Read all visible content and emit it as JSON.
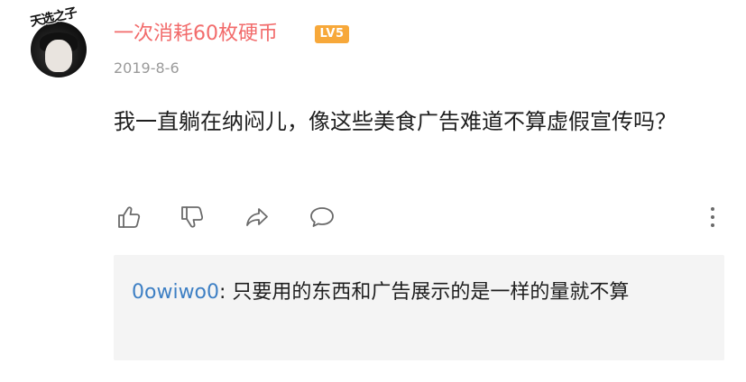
{
  "comment": {
    "username": "一次消耗60枚硬币",
    "level": "LV5",
    "date": "2019-8-6",
    "text": "我一直躺在纳闷儿，像这些美食广告难道不算虚假宣传吗？",
    "avatar_sticker_text": "天选之子"
  },
  "actions": {
    "like_icon": "thumbs-up-icon",
    "dislike_icon": "thumbs-down-icon",
    "share_icon": "share-arrow-icon",
    "comment_icon": "speech-bubble-icon",
    "more_icon": "vertical-ellipsis-icon"
  },
  "reply": {
    "username": "0owiwo0",
    "separator": ": ",
    "text": "只要用的东西和广告展示的是一样的量就不算"
  },
  "colors": {
    "username": "#f26b6b",
    "level_badge": "#f7a83a",
    "reply_username": "#3d7fc4",
    "reply_background": "#f4f4f4",
    "date": "#9a9a9a",
    "icon": "#6a6a6a"
  }
}
